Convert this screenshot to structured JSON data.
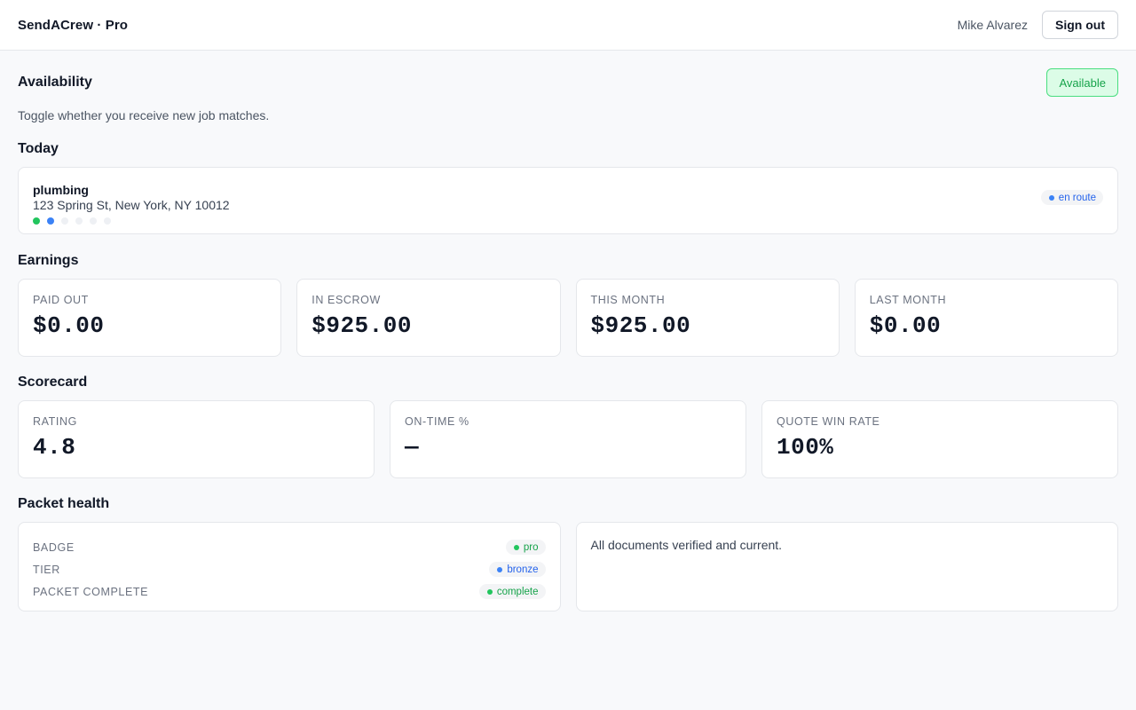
{
  "header": {
    "brand": "SendACrew · Pro",
    "user_name": "Mike Alvarez",
    "signout_label": "Sign out"
  },
  "availability": {
    "title": "Availability",
    "status_label": "Available",
    "description": "Toggle whether you receive new job matches."
  },
  "today": {
    "title": "Today",
    "job": {
      "type": "plumbing",
      "address": "123 Spring St, New York, NY 10012",
      "status": "en route",
      "progress_steps_total": 6,
      "progress_steps_done": 2
    }
  },
  "earnings": {
    "title": "Earnings",
    "stats": [
      {
        "label": "PAID OUT",
        "value": "$0.00"
      },
      {
        "label": "IN ESCROW",
        "value": "$925.00"
      },
      {
        "label": "THIS MONTH",
        "value": "$925.00"
      },
      {
        "label": "LAST MONTH",
        "value": "$0.00"
      }
    ]
  },
  "scorecard": {
    "title": "Scorecard",
    "stats": [
      {
        "label": "RATING",
        "value": "4.8"
      },
      {
        "label": "ON-TIME %",
        "value": "—"
      },
      {
        "label": "QUOTE WIN RATE",
        "value": "100%"
      }
    ]
  },
  "packet": {
    "title": "Packet health",
    "rows": [
      {
        "label": "BADGE",
        "value": "pro"
      },
      {
        "label": "TIER",
        "value": "bronze"
      },
      {
        "label": "PACKET COMPLETE",
        "value": "complete"
      }
    ],
    "status_message": "All documents verified and current."
  },
  "colors": {
    "accent_green": "#16a34a",
    "accent_blue": "#2563eb",
    "background": "#f8f9fb"
  }
}
